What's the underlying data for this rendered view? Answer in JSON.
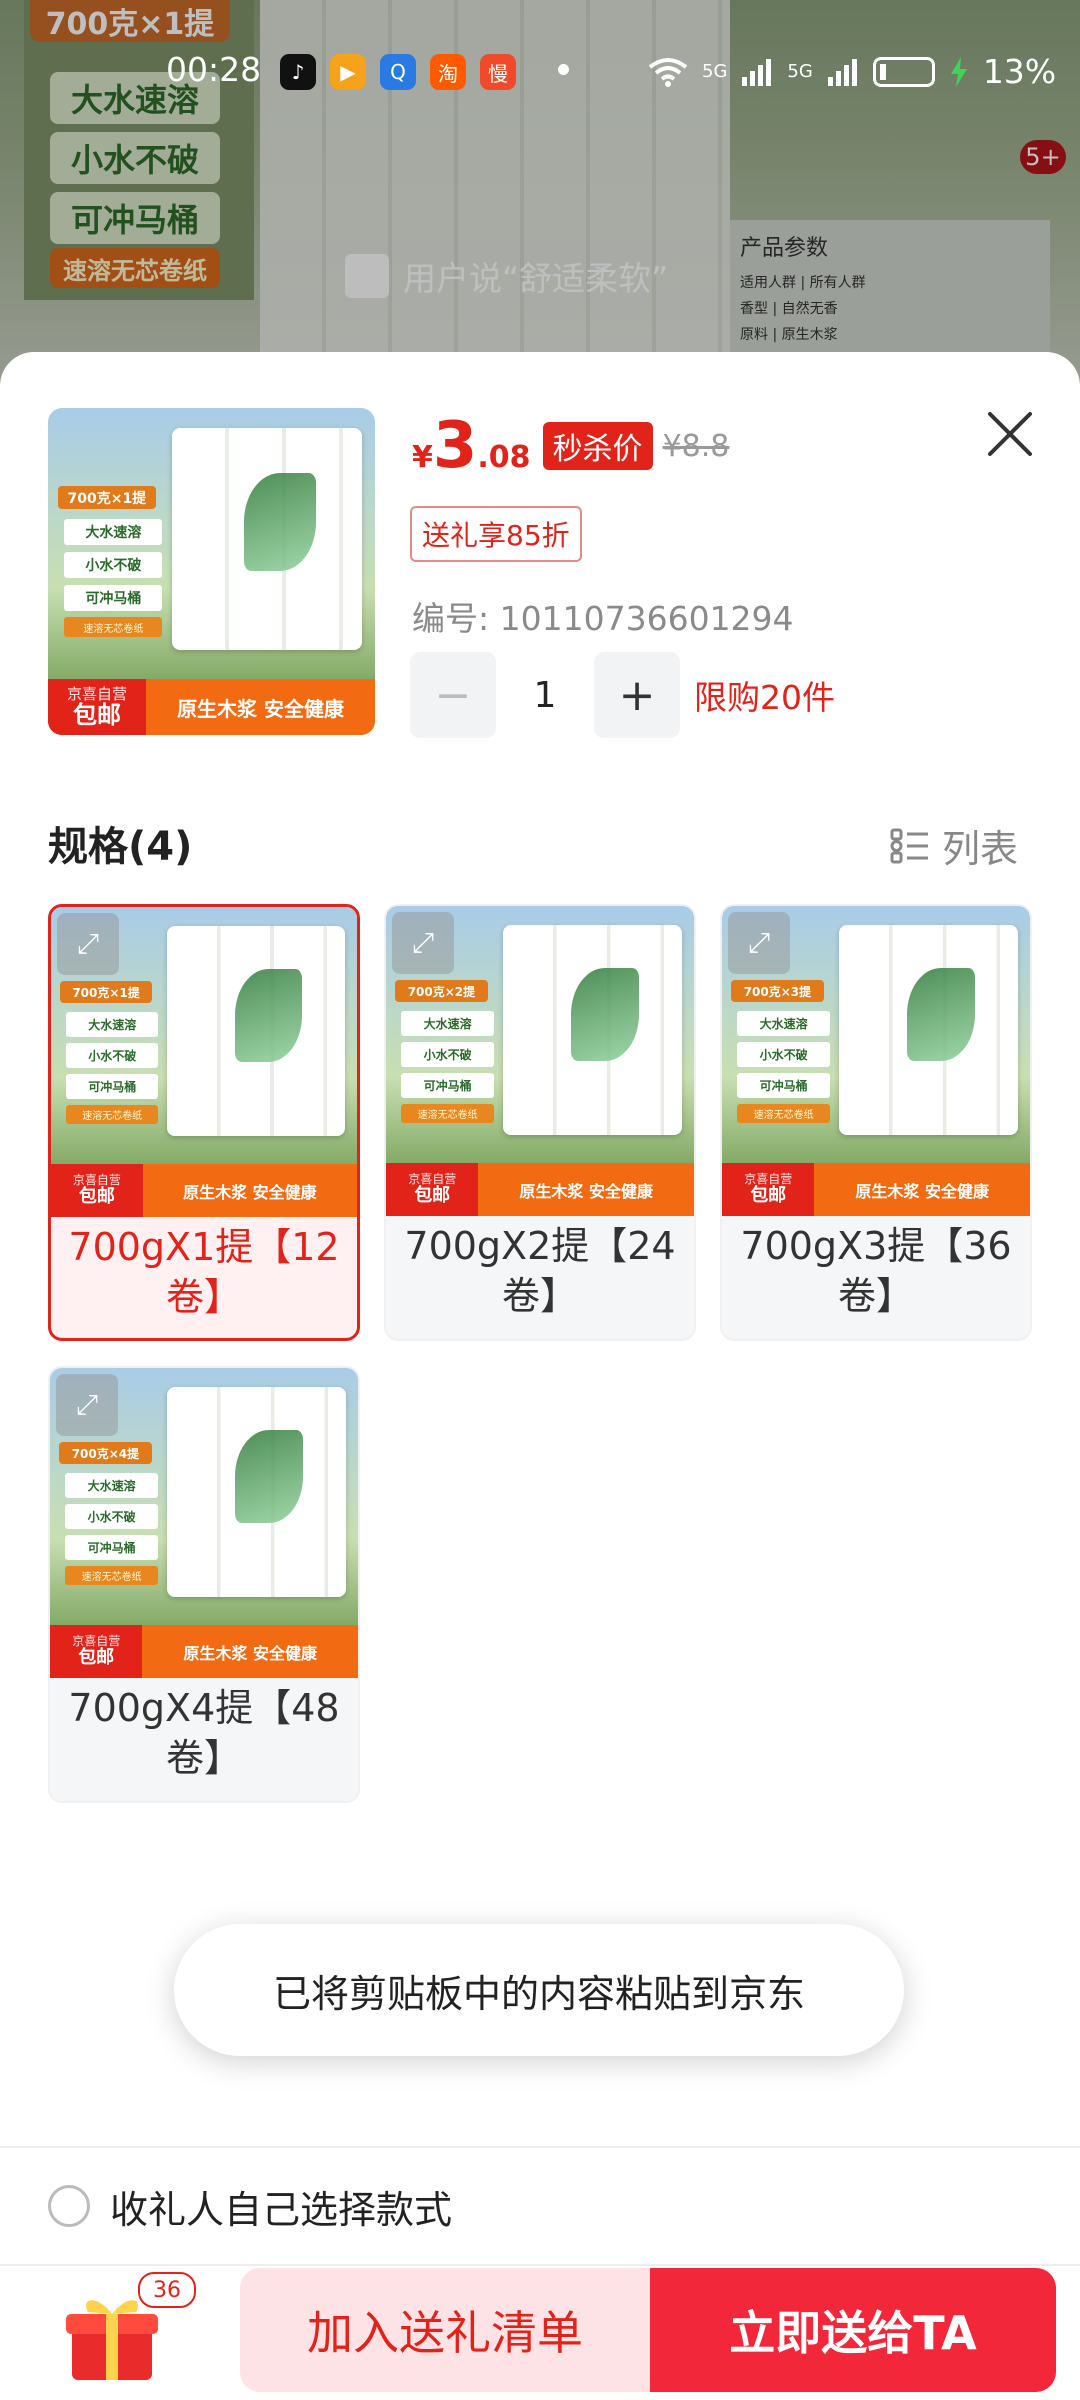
{
  "status_bar": {
    "time": "00:28",
    "apps": [
      {
        "icon": "douyin-icon",
        "glyph": "♪",
        "color": "#111111"
      },
      {
        "icon": "video-app-icon",
        "glyph": "▶",
        "color": "#f7a21b"
      },
      {
        "icon": "search-app-icon",
        "glyph": "Q",
        "color": "#2a7ae4"
      },
      {
        "icon": "taobao-icon",
        "glyph": "淘",
        "color": "#ff5a00"
      },
      {
        "icon": "manman-icon",
        "glyph": "慢",
        "color": "#f04a2a"
      }
    ],
    "network": "5G",
    "network2": "5G",
    "battery": "13%"
  },
  "background": {
    "top_tag": "700克×1提",
    "tags": [
      "大水速溶",
      "小水不破",
      "可冲马桶"
    ],
    "orange_tag": "速溶无芯卷纸",
    "review": "用户说“舒适柔软”",
    "badge": "5+",
    "params_title": "产品参数",
    "params_lines": [
      "适用人群 | 所有人群",
      "香型 | 自然无香",
      "原料 | 原生木浆"
    ]
  },
  "product": {
    "price_symbol": "¥",
    "price_int": "3",
    "price_dec": ".08",
    "flash_label": "秒杀价",
    "original_price": "¥8.8",
    "gift_discount": "送礼享85折",
    "code": "编号: 10110736601294",
    "quantity": "1",
    "minus": "−",
    "plus": "+",
    "limit": "限购20件",
    "thumb": {
      "pack_label": "700克×1提",
      "features": [
        "大水速溶",
        "小水不破",
        "可冲马桶"
      ],
      "quick_label": "速溶无芯卷纸",
      "jd_small": "京喜自营",
      "jd_big": "包邮",
      "slogan": "原生木浆 安全健康"
    }
  },
  "specs": {
    "title": "规格(4)",
    "list_label": "列表",
    "items": [
      {
        "name": "700gX1提【12卷】",
        "pack_label": "700克×1提",
        "selected": true
      },
      {
        "name": "700gX2提【24卷】",
        "pack_label": "700克×2提",
        "selected": false
      },
      {
        "name": "700gX3提【36卷】",
        "pack_label": "700克×3提",
        "selected": false
      },
      {
        "name": "700gX4提【48卷】",
        "pack_label": "700克×4提",
        "selected": false
      }
    ],
    "features": [
      "大水速溶",
      "小水不破",
      "可冲马桶"
    ],
    "quick_label": "速溶无芯卷纸",
    "jd_small": "京喜自营",
    "jd_big": "包邮",
    "slogan": "原生木浆 安全健康"
  },
  "toast": "已将剪贴板中的内容粘贴到京东",
  "self_select": {
    "label": "收礼人自己选择款式"
  },
  "bottom": {
    "gift_count": "36",
    "add_label": "加入送礼清单",
    "send_label": "立即送给TA"
  },
  "colors": {
    "accent": "#e2231a",
    "button_light": "#fde3e6",
    "button_primary": "#f2273a"
  }
}
